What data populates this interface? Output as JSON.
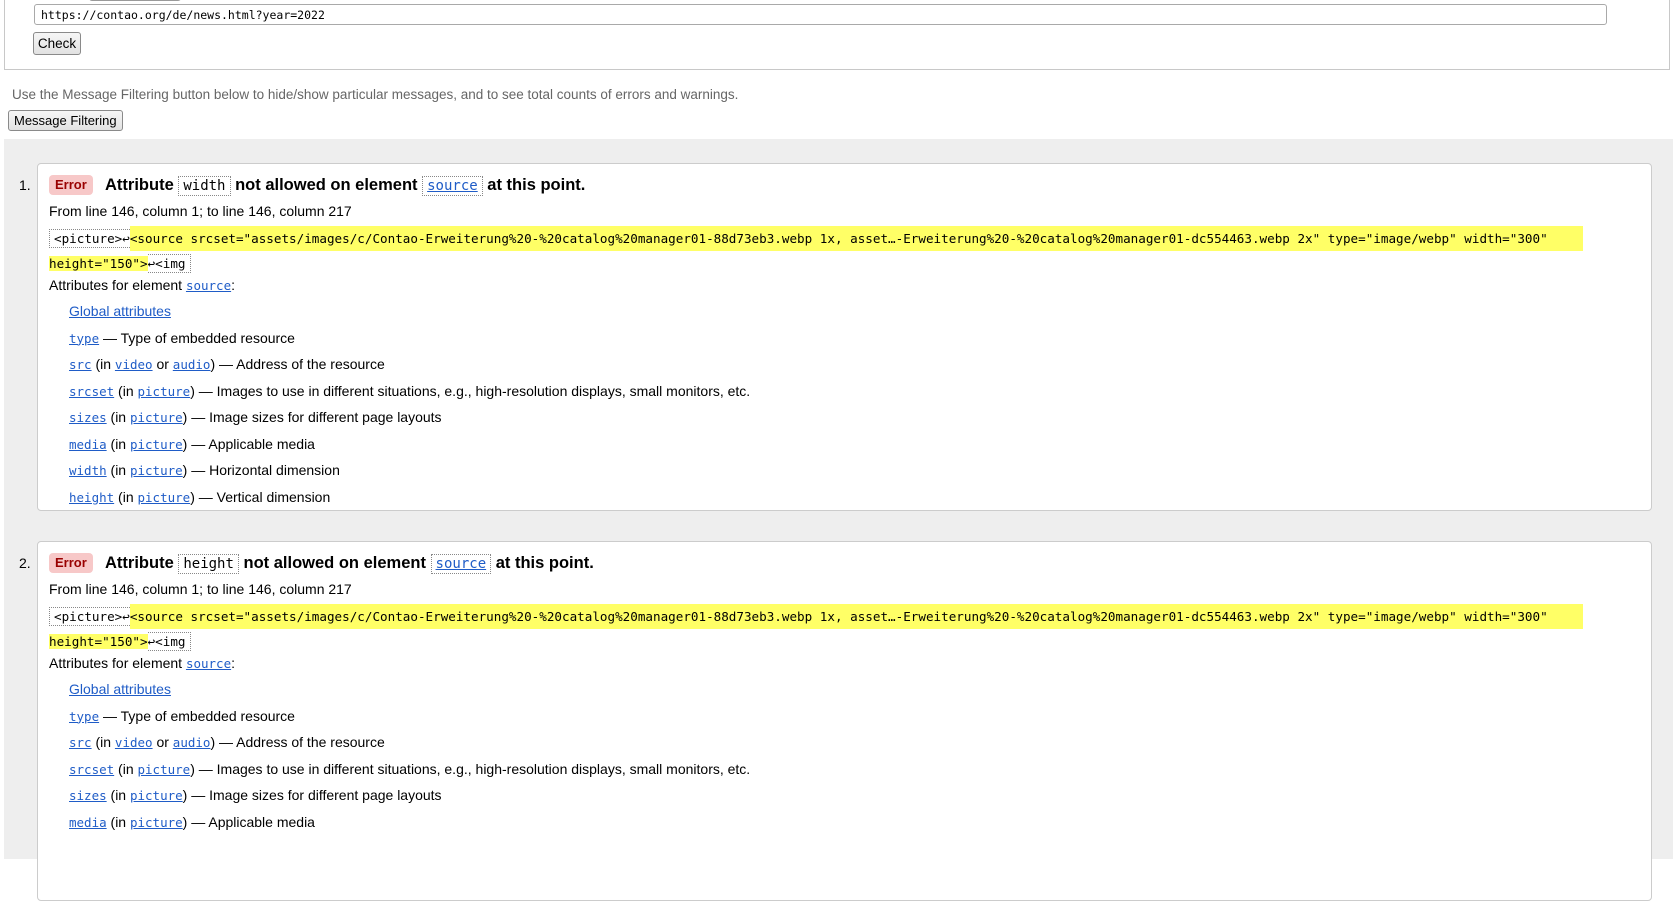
{
  "form": {
    "url_value": "https://contao.org/de/news.html?year=2022",
    "check_label": "Check"
  },
  "help_text": "Use the Message Filtering button below to hide/show particular messages, and to see total counts of errors and warnings.",
  "filter_label": "Message Filtering",
  "messages": [
    {
      "number": "1.",
      "type": "Error",
      "title_pre": "Attribute",
      "attribute": "width",
      "title_mid": "not allowed on element",
      "element": "source",
      "title_post": "at this point.",
      "location": "From line 146, column 1; to line 146, column 217",
      "extract_pre": "<picture>↩",
      "extract_hl_1": "<source srcset=\"assets/images/c/Contao-Erweiterung%20-%20catalog%20manager01-88d73eb3.webp 1x, asset…-Erweiterung%20-%20catalog%20manager01-dc554463.webp 2x\" type=\"image/webp\" width=\"300\"",
      "extract_hl_2": "height=\"150\">",
      "extract_post": "↩<img",
      "attrs_label": "Attributes for element",
      "attrs_element": "source"
    },
    {
      "number": "2.",
      "type": "Error",
      "title_pre": "Attribute",
      "attribute": "height",
      "title_mid": "not allowed on element",
      "element": "source",
      "title_post": "at this point.",
      "location": "From line 146, column 1; to line 146, column 217",
      "extract_pre": "<picture>↩",
      "extract_hl_1": "<source srcset=\"assets/images/c/Contao-Erweiterung%20-%20catalog%20manager01-88d73eb3.webp 1x, asset…-Erweiterung%20-%20catalog%20manager01-dc554463.webp 2x\" type=\"image/webp\" width=\"300\"",
      "extract_hl_2": "height=\"150\">",
      "extract_post": "↩<img",
      "attrs_label": "Attributes for element",
      "attrs_element": "source"
    }
  ],
  "attributes": {
    "global": "Global attributes",
    "type": "type",
    "type_desc": "— Type of embedded resource",
    "src": "src",
    "in_open": "(in",
    "video": "video",
    "or": "or",
    "audio": "audio",
    "close": ")",
    "src_desc": "— Address of the resource",
    "srcset": "srcset",
    "picture": "picture",
    "srcset_desc": "— Images to use in different situations, e.g., high-resolution displays, small monitors, etc.",
    "sizes": "sizes",
    "sizes_desc": "— Image sizes for different page layouts",
    "media": "media",
    "media_desc": "— Applicable media",
    "width": "width",
    "width_desc": "— Horizontal dimension",
    "height": "height",
    "height_desc": "— Vertical dimension"
  },
  "colors": {
    "highlight": "#ffff66",
    "error_badge_bg": "#f7c8c8",
    "error_badge_text": "#990000",
    "link": "#1f5cc7"
  }
}
